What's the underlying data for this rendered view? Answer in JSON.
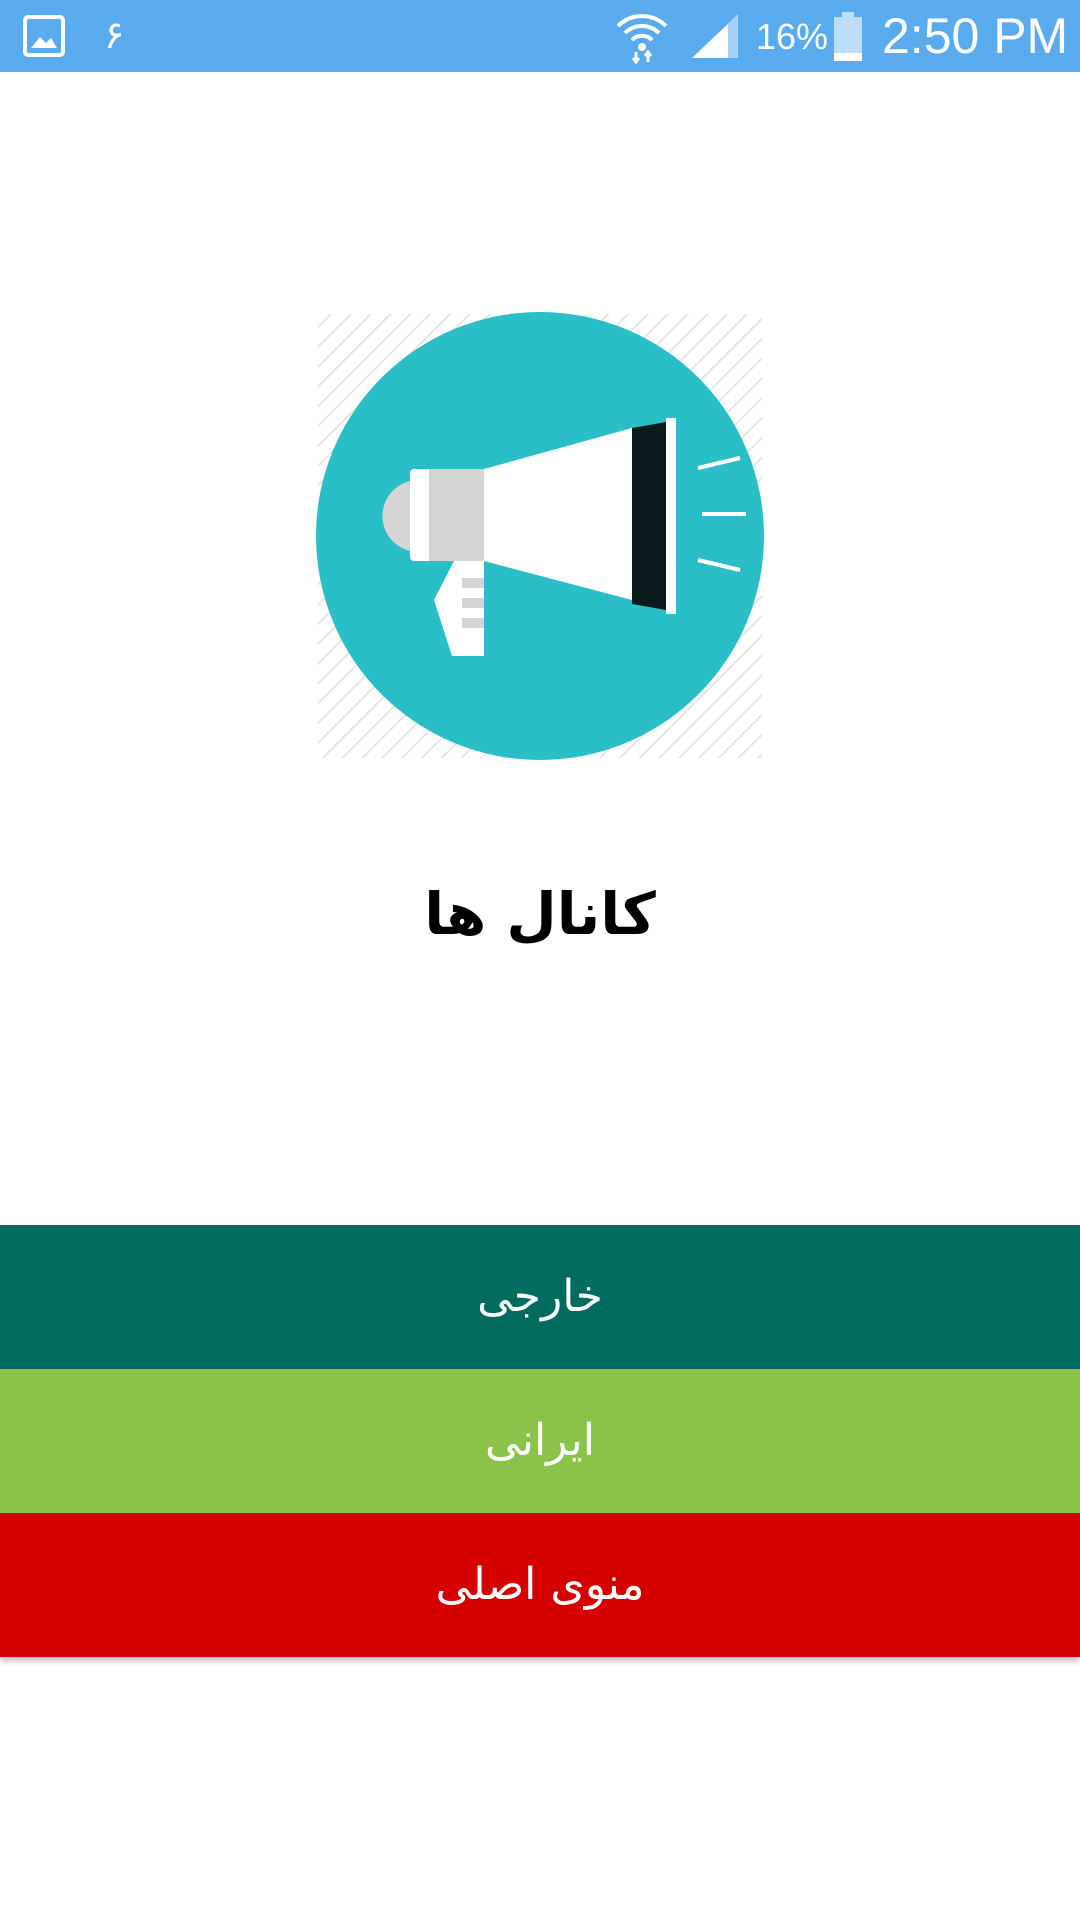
{
  "status_bar": {
    "notification_digit": "۶",
    "battery_percent": "16%",
    "time": "2:50 PM",
    "background_color": "#5aabee",
    "icons": [
      "gallery-icon",
      "wifi-icon",
      "signal-icon",
      "battery-icon"
    ]
  },
  "hero": {
    "icon": "megaphone-icon",
    "circle_color": "#2abfc6"
  },
  "page": {
    "title": "کانال ها"
  },
  "menu": {
    "items": [
      {
        "label": "خارجی",
        "color": "#006b5e"
      },
      {
        "label": "ایرانی",
        "color": "#8bc34a"
      },
      {
        "label": "منوی اصلی",
        "color": "#d50000"
      }
    ]
  }
}
